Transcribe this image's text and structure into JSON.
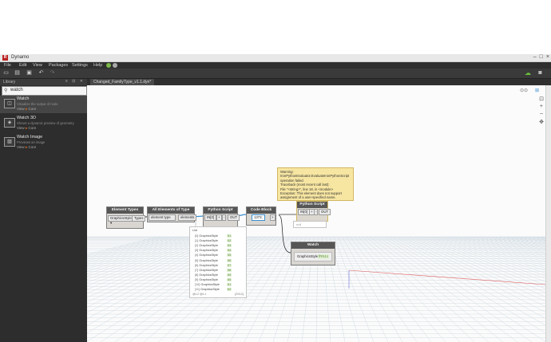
{
  "app": {
    "title": "Dynamo",
    "logo": "R"
  },
  "menu": {
    "items": [
      "File",
      "Edit",
      "View",
      "Packages",
      "Settings",
      "Help"
    ]
  },
  "library": {
    "header": "Library",
    "search_value": "watch",
    "items": [
      {
        "name": "Watch",
        "desc": "Visualize the output of node",
        "category_prefix": "View",
        "category": "Core",
        "icon": "watch-icon"
      },
      {
        "name": "Watch 3D",
        "desc": "Shows a dynamic preview of geometry",
        "category_prefix": "View",
        "category": "Core",
        "icon": "watch3d-icon"
      },
      {
        "name": "Watch Image",
        "desc": "Previews an image",
        "category_prefix": "View",
        "category": "Core",
        "icon": "watch-image-icon"
      }
    ]
  },
  "canvas": {
    "tab_label": "Changed_FamilyType_v1.1.dyn*"
  },
  "nodes": {
    "element_types": {
      "title": "Element Types",
      "dropdown": "GraphicsStyle",
      "output": "Types"
    },
    "all_elements": {
      "title": "All Elements of Type",
      "input": "element type",
      "output": "elements"
    },
    "python1": {
      "title": "Python Script",
      "input": "IN[0]",
      "plus": "+",
      "minus": "-",
      "output": "OUT"
    },
    "code_block": {
      "title": "Code Block",
      "value": "1373;",
      "output": ">"
    },
    "python2": {
      "title": "Python Script",
      "input": "IN[0]",
      "plus": "+",
      "minus": "-",
      "output": "OUT"
    },
    "watch": {
      "title": "Watch",
      "row_label": "GraphicsStyle",
      "row_tag": "fRN14"
    }
  },
  "warning": {
    "lines": [
      "Warning:",
      "IronPythonEvaluator.EvaluateIronPythonScript",
      "operation failed.",
      "Traceback (most recent call last):",
      "  File \"<string>\", line 18, in <module>",
      "Exception: This element does not support",
      "assignment of a user-specified name."
    ]
  },
  "python2_preview": "null",
  "watch_list": {
    "header": "List",
    "rows": [
      {
        "idx": "[0]",
        "text": "GraphicsStyle",
        "tag": "51"
      },
      {
        "idx": "[1]",
        "text": "GraphicsStyle",
        "tag": "52"
      },
      {
        "idx": "[2]",
        "text": "GraphicsStyle",
        "tag": "53"
      },
      {
        "idx": "[3]",
        "text": "GraphicsStyle",
        "tag": "54"
      },
      {
        "idx": "[4]",
        "text": "GraphicsStyle",
        "tag": "55"
      },
      {
        "idx": "[5]",
        "text": "GraphicsStyle",
        "tag": "56"
      },
      {
        "idx": "[6]",
        "text": "GraphicsStyle",
        "tag": "57"
      },
      {
        "idx": "[7]",
        "text": "GraphicsStyle",
        "tag": "58"
      },
      {
        "idx": "[8]",
        "text": "GraphicsStyle",
        "tag": "59"
      },
      {
        "idx": "[9]",
        "text": "GraphicsStyle",
        "tag": "60"
      },
      {
        "idx": "[10]",
        "text": "GraphicsStyle",
        "tag": "61"
      },
      {
        "idx": "[11]",
        "text": "GraphicsStyle",
        "tag": "62"
      }
    ],
    "footer_left": "@L2 @L1",
    "footer_right": "{2912}"
  },
  "colors": {
    "accent_green": "#6abf3c",
    "dark_panel": "#2d2d2d",
    "node_header": "#565656",
    "warning_bg": "#f7e6a2",
    "wire": "#3a8fd0"
  }
}
